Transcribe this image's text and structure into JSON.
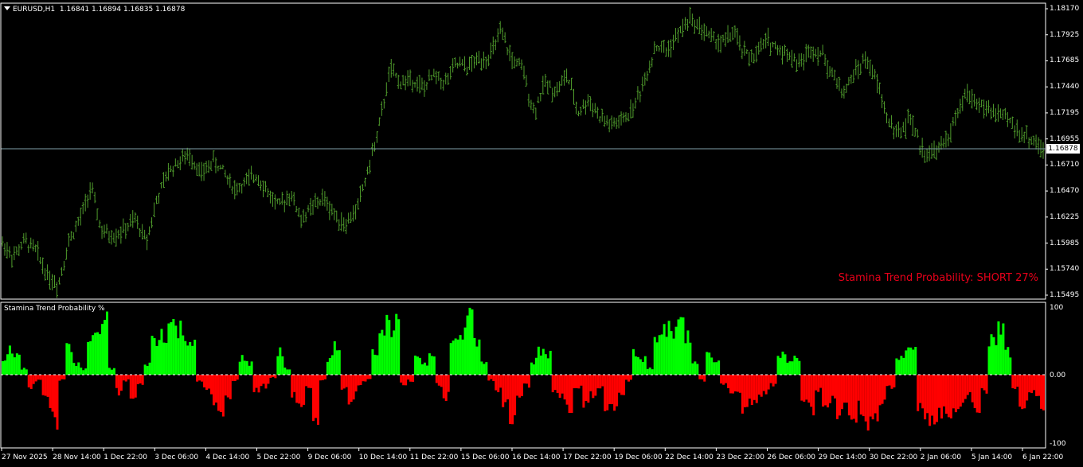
{
  "symbol_info": {
    "symbol": "EURUSD,H1",
    "ohlc": "1.16841 1.16894 1.16835 1.16878"
  },
  "price_axis": [
    "1.18170",
    "1.17925",
    "1.17685",
    "1.17440",
    "1.17195",
    "1.16955",
    "1.16710",
    "1.16470",
    "1.16225",
    "1.15985",
    "1.15740",
    "1.15495"
  ],
  "current_price": "1.16878",
  "indicator": {
    "title": "Stamina Trend Probability %",
    "axis": [
      "100",
      "0.00",
      "-100"
    ],
    "signal": "Stamina Trend Probability: SHORT 27%"
  },
  "time_axis": [
    "27 Nov 2025",
    "28 Nov 14:00",
    "1 Dec 22:00",
    "3 Dec 06:00",
    "4 Dec 14:00",
    "5 Dec 22:00",
    "9 Dec 06:00",
    "10 Dec 14:00",
    "11 Dec 22:00",
    "15 Dec 06:00",
    "16 Dec 14:00",
    "17 Dec 22:00",
    "19 Dec 06:00",
    "22 Dec 14:00",
    "23 Dec 22:00",
    "26 Dec 06:00",
    "29 Dec 14:00",
    "30 Dec 22:00",
    "2 Jan 06:00",
    "5 Jan 14:00",
    "6 Jan 22:00"
  ],
  "colors": {
    "background": "#000000",
    "bars": "#4f9b2c",
    "grid_frame": "#ffffff",
    "current_price_line": "#7f9fa8",
    "positive_hist": "#00ff00",
    "negative_hist": "#ff0000",
    "signal_text": "#e8001a"
  },
  "chart_data": [
    {
      "type": "line",
      "title": "EURUSD,H1",
      "ylim": [
        1.15495,
        1.1817
      ],
      "ylabel": "",
      "xlabel": "",
      "series": [
        {
          "name": "EURUSD,H1",
          "values": [
            1.1598,
            1.1585,
            1.16,
            1.1592,
            1.157,
            1.1558,
            1.16,
            1.162,
            1.165,
            1.1608,
            1.1605,
            1.161,
            1.162,
            1.16,
            1.164,
            1.1665,
            1.1675,
            1.168,
            1.1662,
            1.1675,
            1.1665,
            1.1648,
            1.1655,
            1.1662,
            1.1645,
            1.1632,
            1.1645,
            1.162,
            1.1632,
            1.164,
            1.1625,
            1.1615,
            1.163,
            1.1665,
            1.1705,
            1.176,
            1.1748,
            1.1752,
            1.1742,
            1.1755,
            1.1748,
            1.1765,
            1.1762,
            1.177,
            1.1772,
            1.1795,
            1.177,
            1.176,
            1.172,
            1.1748,
            1.174,
            1.1755,
            1.172,
            1.1732,
            1.1715,
            1.1708,
            1.1712,
            1.1725,
            1.175,
            1.1782,
            1.1778,
            1.1792,
            1.1808,
            1.18,
            1.179,
            1.1785,
            1.1795,
            1.1775,
            1.1772,
            1.1788,
            1.178,
            1.1775,
            1.1765,
            1.178,
            1.1775,
            1.1755,
            1.1738,
            1.1758,
            1.177,
            1.1748,
            1.1712,
            1.17,
            1.1715,
            1.1685,
            1.1682,
            1.169,
            1.171,
            1.1738,
            1.173,
            1.1722,
            1.1718,
            1.1712,
            1.17,
            1.1695,
            1.1685
          ]
        }
      ]
    },
    {
      "type": "bar",
      "title": "Stamina Trend Probability %",
      "ylim": [
        -100,
        100
      ],
      "series": [
        {
          "name": "",
          "values": [
            20,
            45,
            35,
            10,
            -20,
            -10,
            -45,
            -80,
            -10,
            45,
            20,
            10,
            60,
            75,
            90,
            10,
            -30,
            -10,
            -40,
            -15,
            20,
            60,
            75,
            90,
            80,
            70,
            60,
            -10,
            -25,
            -45,
            -60,
            -40,
            -10,
            30,
            20,
            -30,
            -20,
            -5,
            40,
            10,
            -40,
            -60,
            -20,
            -70,
            -10,
            30,
            50,
            -30,
            -45,
            -25,
            -10,
            45,
            80,
            90,
            85,
            -15,
            -10,
            35,
            20,
            40,
            -20,
            -40,
            55,
            70,
            95,
            60,
            20,
            -10,
            -30,
            -55,
            -80,
            -50,
            -20,
            25,
            40,
            35,
            -30,
            -45,
            -60,
            -20,
            -50,
            -40,
            -20,
            -55,
            -60,
            -30,
            -10,
            40,
            30,
            10,
            60,
            80,
            85,
            90,
            70,
            25,
            -10,
            40,
            20,
            -20,
            -30,
            -35,
            -60,
            -50,
            -40,
            -30,
            -20,
            40,
            20,
            30,
            -40,
            -60,
            -30,
            -50,
            -45,
            -70,
            -60,
            -80,
            -60,
            -90,
            -70,
            -50,
            -20,
            30,
            40,
            45,
            -60,
            -80,
            -70,
            -65,
            -85,
            -60,
            -50,
            -40,
            -55,
            -30,
            60,
            80,
            40,
            -20,
            -50,
            -40,
            -30,
            -50
          ]
        }
      ]
    }
  ]
}
